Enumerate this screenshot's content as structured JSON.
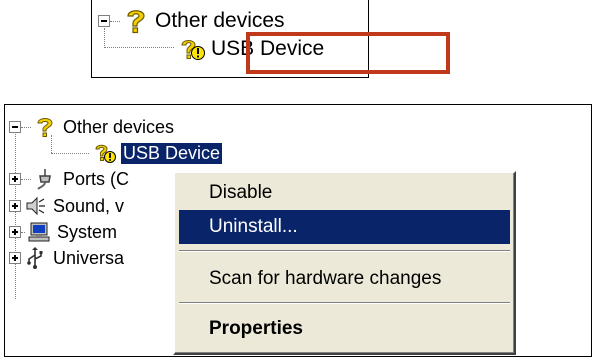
{
  "top_zoom": {
    "items": [
      {
        "label": "Other devices",
        "icon": "question-mark-icon"
      },
      {
        "label": "USB Device",
        "icon": "warning-device-icon"
      }
    ],
    "highlight_color": "#c0391b"
  },
  "tree": {
    "items": [
      {
        "label": "Other devices",
        "icon": "question-mark-icon",
        "expanded": true
      },
      {
        "label": "USB Device",
        "icon": "warning-device-icon",
        "selected": true
      },
      {
        "label": "Ports (C",
        "icon": "port-icon",
        "expanded": false
      },
      {
        "label": "Sound, v",
        "icon": "speaker-icon",
        "expanded": false
      },
      {
        "label": "System",
        "icon": "computer-icon",
        "expanded": false
      },
      {
        "label": "Universa",
        "icon": "usb-icon",
        "expanded": false
      }
    ],
    "selection_color": "#0a246a"
  },
  "context_menu": {
    "items": [
      {
        "label": "Disable"
      },
      {
        "label": "Uninstall...",
        "active": true
      },
      {
        "label": "Scan for hardware changes"
      },
      {
        "label": "Properties",
        "bold": true
      }
    ]
  }
}
